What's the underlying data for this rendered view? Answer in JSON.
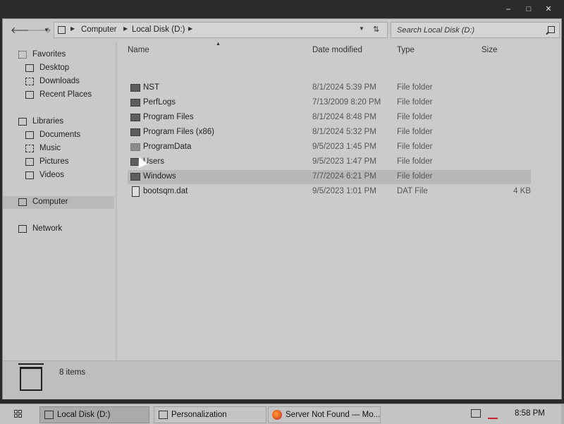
{
  "window": {
    "controls": {
      "minimize": "–",
      "maximize": "□",
      "close": "✕"
    }
  },
  "toolbar": {
    "back_icon": "arrow-left-icon",
    "forward_icon": "arrow-right-icon",
    "recent_icon": "chevron-down-icon",
    "breadcrumbs": [
      "Computer",
      "Local Disk (D:)"
    ],
    "search_placeholder": "Search Local Disk (D:)"
  },
  "sidebar": {
    "favorites": {
      "label": "Favorites",
      "items": [
        "Desktop",
        "Downloads",
        "Recent Places"
      ]
    },
    "libraries": {
      "label": "Libraries",
      "items": [
        "Documents",
        "Music",
        "Pictures",
        "Videos"
      ]
    },
    "computer": "Computer",
    "network": "Network",
    "selected": "Computer"
  },
  "columns": {
    "name": "Name",
    "date": "Date modified",
    "type": "Type",
    "size": "Size"
  },
  "files": [
    {
      "name": "NST",
      "date": "8/1/2024 5:39 PM",
      "type": "File folder",
      "size": "",
      "icon": "folder-icon"
    },
    {
      "name": "PerfLogs",
      "date": "7/13/2009 8:20 PM",
      "type": "File folder",
      "size": "",
      "icon": "folder-icon"
    },
    {
      "name": "Program Files",
      "date": "8/1/2024 8:48 PM",
      "type": "File folder",
      "size": "",
      "icon": "folder-icon"
    },
    {
      "name": "Program Files (x86)",
      "date": "8/1/2024 5:32 PM",
      "type": "File folder",
      "size": "",
      "icon": "folder-icon"
    },
    {
      "name": "ProgramData",
      "date": "9/5/2023 1:45 PM",
      "type": "File folder",
      "size": "",
      "icon": "folder-icon"
    },
    {
      "name": "Users",
      "date": "9/5/2023 1:47 PM",
      "type": "File folder",
      "size": "",
      "icon": "folder-icon"
    },
    {
      "name": "Windows",
      "date": "7/7/2024 6:21 PM",
      "type": "File folder",
      "size": "",
      "icon": "folder-icon",
      "hovered": true
    },
    {
      "name": "bootsqm.dat",
      "date": "9/5/2023 1:01 PM",
      "type": "DAT File",
      "size": "4 KB",
      "icon": "file-icon"
    }
  ],
  "details": {
    "count": "8 items"
  },
  "taskbar": {
    "items": [
      {
        "label": "Local Disk (D:)",
        "active": true,
        "icon": "folder-window-icon"
      },
      {
        "label": "Personalization",
        "active": false,
        "icon": "settings-window-icon"
      },
      {
        "label": "Server Not Found — Mo...",
        "active": false,
        "icon": "firefox-icon"
      }
    ],
    "clock": "8:58 PM"
  }
}
